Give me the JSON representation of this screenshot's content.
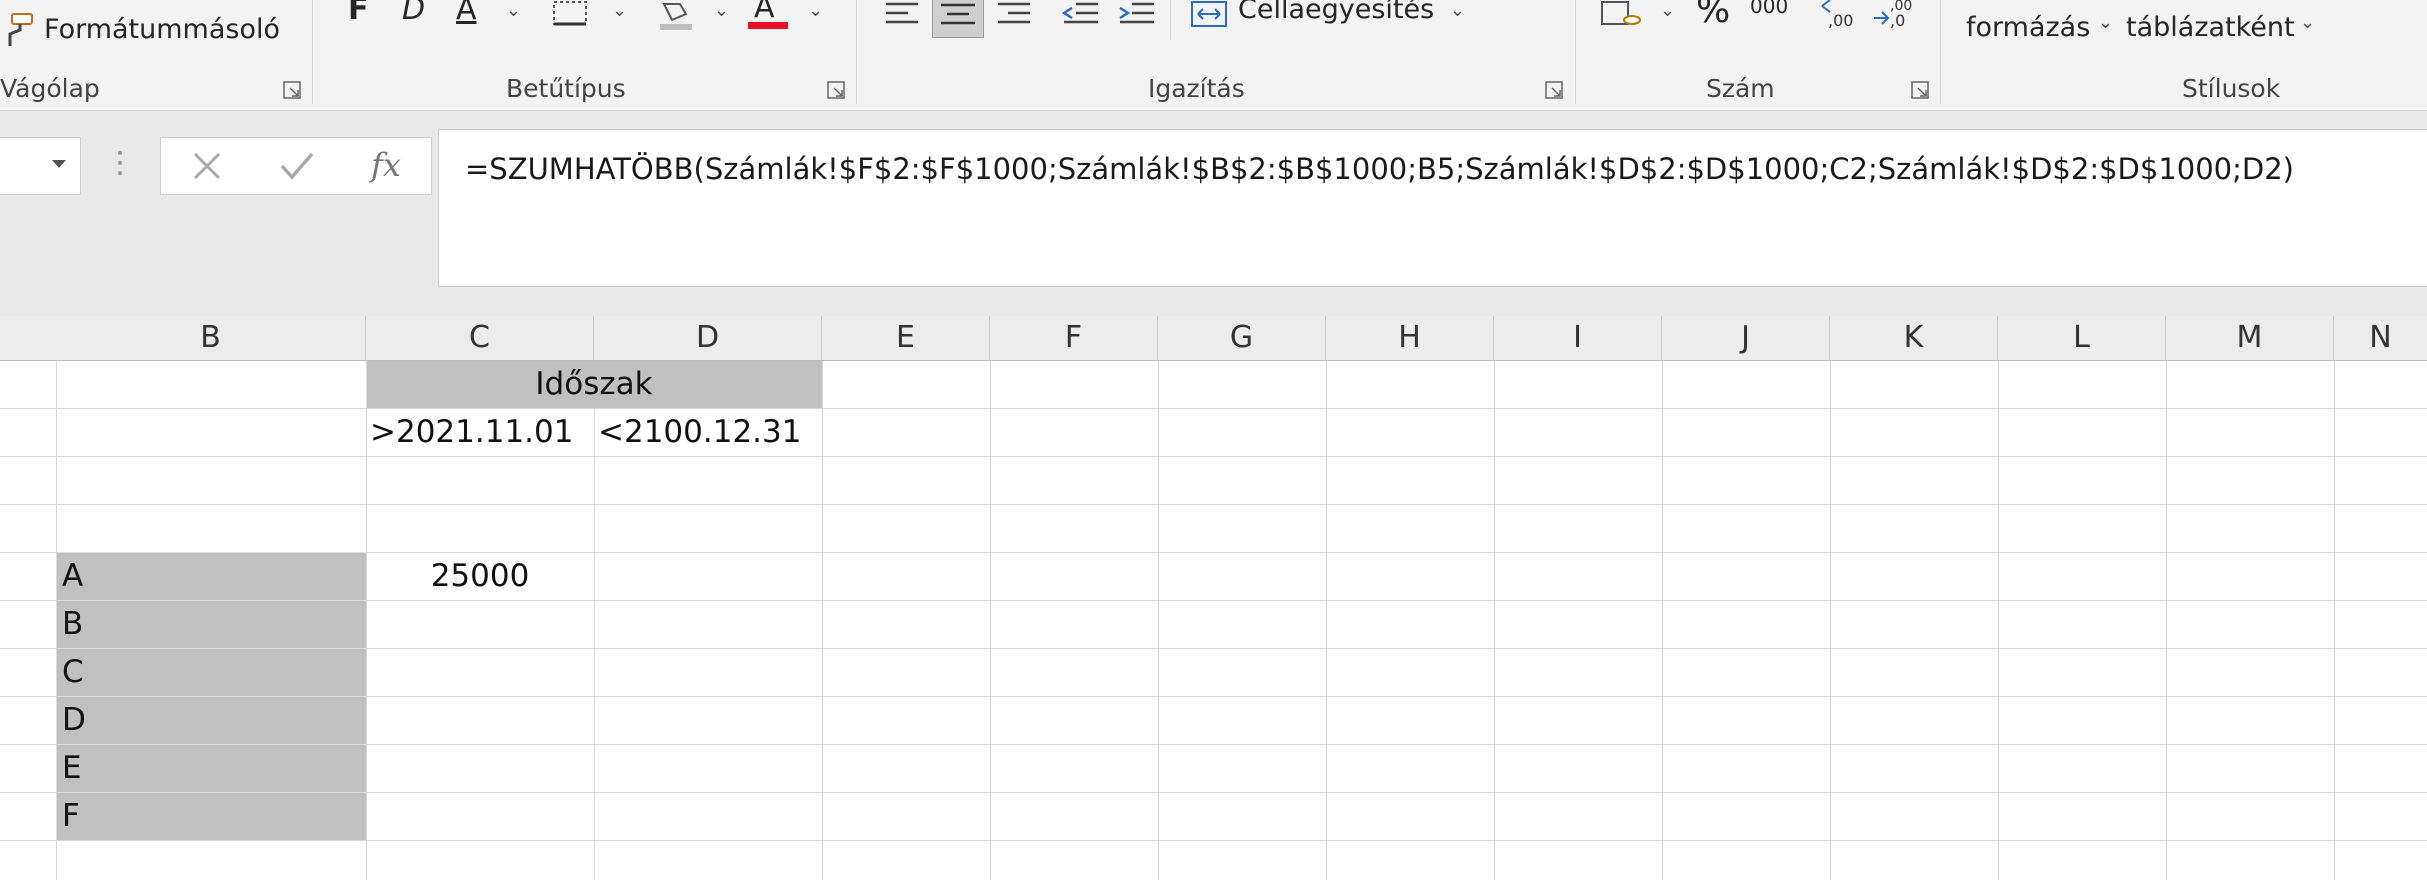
{
  "ribbon": {
    "clipboard": {
      "format_painter": "Formátummásoló",
      "group_label": "Vágólap"
    },
    "font": {
      "bold": "F",
      "italic": "D",
      "underline": "A",
      "font_color_letter": "A",
      "font_color": "#e81123",
      "group_label": "Betűtípus"
    },
    "alignment": {
      "merge_label": "Cellaegyesítés",
      "group_label": "Igazítás"
    },
    "number": {
      "percent": "%",
      "thousands": "000",
      "group_label": "Szám"
    },
    "styles": {
      "conditional_label": "formázás",
      "format_as_table_label": "táblázatként",
      "group_label": "Stílusok"
    }
  },
  "formula_bar": {
    "fx": "fx",
    "formula": "=SZUMHATÖBB(Számlák!$F$2:$F$1000;Számlák!$B$2:$B$1000;B5;Számlák!$D$2:$D$1000;C2;Számlák!$D$2:$D$1000;D2)"
  },
  "columns": [
    "B",
    "C",
    "D",
    "E",
    "F",
    "G",
    "H",
    "I",
    "J",
    "K",
    "L",
    "M",
    "N"
  ],
  "cells": {
    "period_header": "Időszak",
    "date_from": ">2021.11.01",
    "date_to": "<2100.12.31",
    "categories": [
      "A",
      "B",
      "C",
      "D",
      "E",
      "F"
    ],
    "sum_value": "25000"
  },
  "colors": {
    "cell_fill": "#c0c0c0",
    "ribbon_bg": "#f3f3f3"
  }
}
